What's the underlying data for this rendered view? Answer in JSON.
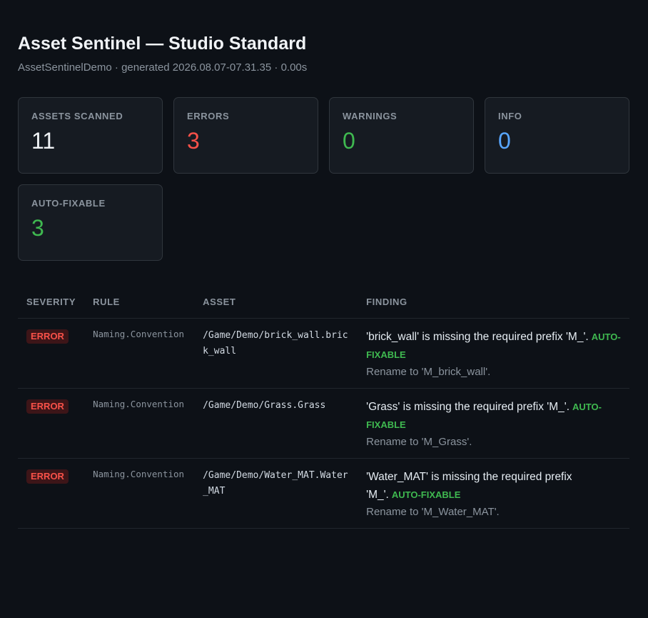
{
  "header": {
    "title": "Asset Sentinel — Studio Standard",
    "subtitle": "AssetSentinelDemo · generated 2026.08.07-07.31.35 · 0.00s"
  },
  "stats": [
    {
      "label": "ASSETS SCANNED",
      "value": "11",
      "color": "#f0f3f6"
    },
    {
      "label": "ERRORS",
      "value": "3",
      "color": "#f85149"
    },
    {
      "label": "WARNINGS",
      "value": "0",
      "color": "#3fb950"
    },
    {
      "label": "INFO",
      "value": "0",
      "color": "#58a6ff"
    },
    {
      "label": "AUTO-FIXABLE",
      "value": "3",
      "color": "#3fb950"
    }
  ],
  "table": {
    "headers": [
      "SEVERITY",
      "RULE",
      "ASSET",
      "FINDING"
    ],
    "rows": [
      {
        "severity": "ERROR",
        "rule": "Naming.Convention",
        "asset": "/Game/Demo/brick_wall.brick_wall",
        "message": "'brick_wall' is missing the required prefix 'M_'.",
        "fixable": "AUTO-FIXABLE",
        "hint": "Rename to 'M_brick_wall'."
      },
      {
        "severity": "ERROR",
        "rule": "Naming.Convention",
        "asset": "/Game/Demo/Grass.Grass",
        "message": "'Grass' is missing the required prefix 'M_'.",
        "fixable": "AUTO-FIXABLE",
        "hint": "Rename to 'M_Grass'."
      },
      {
        "severity": "ERROR",
        "rule": "Naming.Convention",
        "asset": "/Game/Demo/Water_MAT.Water_MAT",
        "message": "'Water_MAT' is missing the required prefix 'M_'.",
        "fixable": "AUTO-FIXABLE",
        "hint": "Rename to 'M_Water_MAT'."
      }
    ]
  }
}
